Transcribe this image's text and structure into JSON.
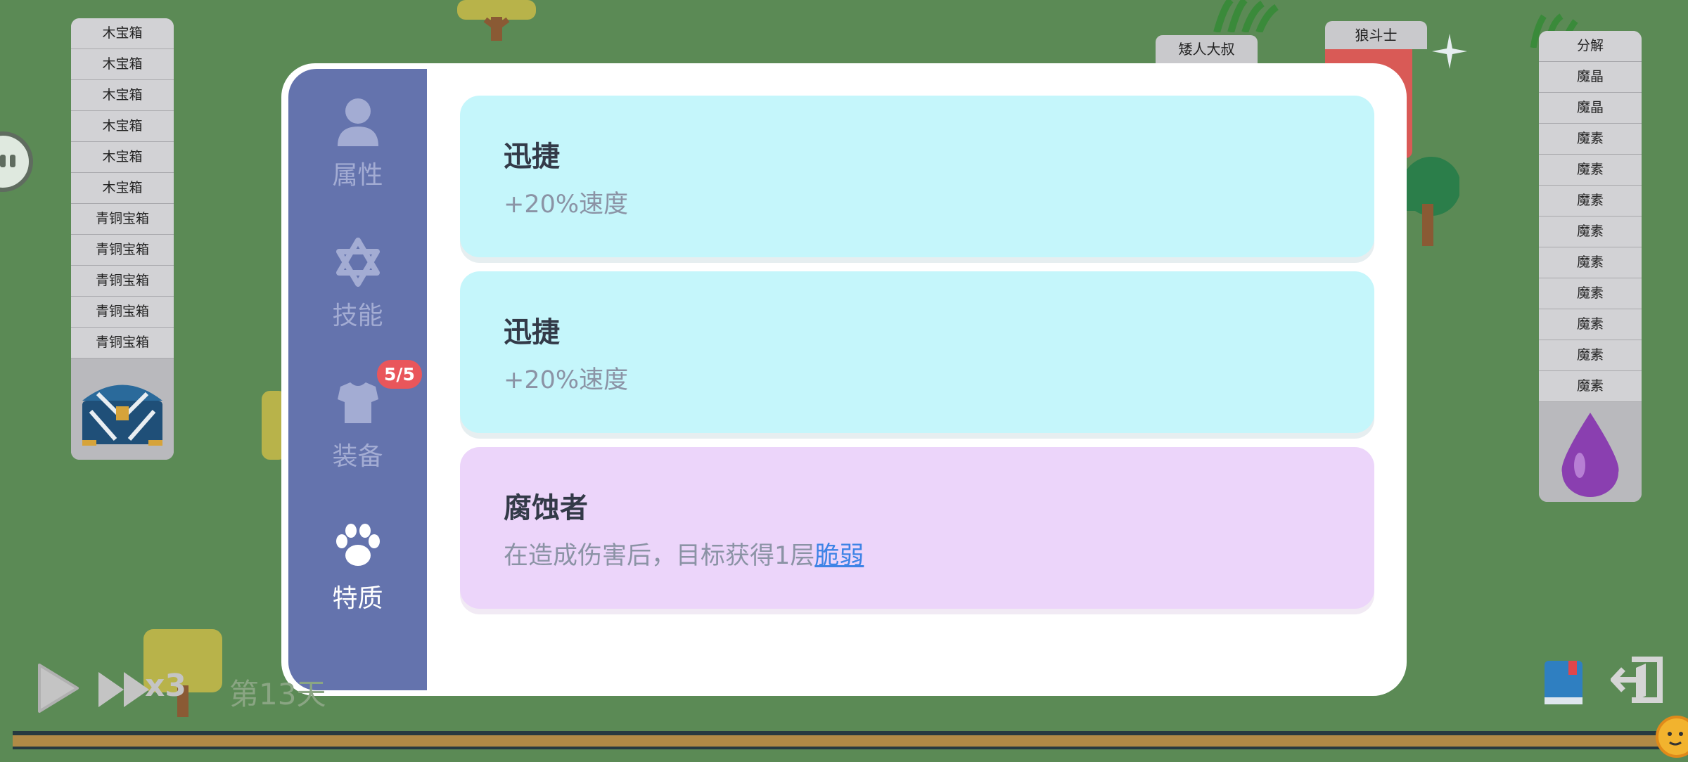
{
  "left_stack": {
    "items": [
      "木宝箱",
      "木宝箱",
      "木宝箱",
      "木宝箱",
      "木宝箱",
      "木宝箱",
      "青铜宝箱",
      "青铜宝箱",
      "青铜宝箱",
      "青铜宝箱",
      "青铜宝箱"
    ]
  },
  "right_stack": {
    "items": [
      "分解",
      "魔晶",
      "魔晶",
      "魔素",
      "魔素",
      "魔素",
      "魔素",
      "魔素",
      "魔素",
      "魔素",
      "魔素",
      "魔素"
    ]
  },
  "top_tags": {
    "dwarf": "矮人大叔",
    "wolf": "狼斗士"
  },
  "sidebar": {
    "tabs": [
      {
        "label": "属性",
        "icon": "person-icon"
      },
      {
        "label": "技能",
        "icon": "star-of-david-icon"
      },
      {
        "label": "装备",
        "icon": "armor-icon"
      },
      {
        "label": "特质",
        "icon": "paw-icon"
      }
    ],
    "active": "特质",
    "equip_badge": "5/5"
  },
  "traits": [
    {
      "title": "迅捷",
      "desc": "+20%速度",
      "color": "#c5f6fb"
    },
    {
      "title": "迅捷",
      "desc": "+20%速度",
      "color": "#c5f6fb"
    },
    {
      "title": "腐蚀者",
      "desc_prefix": "在造成伤害后，目标获得1层",
      "keyword": "脆弱",
      "color": "#ecd5fa"
    }
  ],
  "hud": {
    "speed": "x3",
    "day": "第13天"
  }
}
